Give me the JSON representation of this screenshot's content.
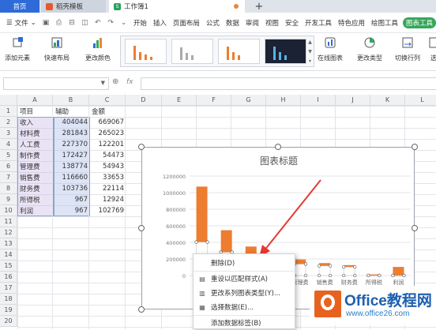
{
  "tabs": {
    "home": "首页",
    "doc": "稻壳模板",
    "workbook": "工作簿1",
    "new_tab": "+"
  },
  "menu": {
    "file": "文件",
    "items": [
      "开始",
      "插入",
      "页面布局",
      "公式",
      "数据",
      "审阅",
      "视图",
      "安全",
      "开发工具",
      "特色应用",
      "绘图工具"
    ],
    "chart_tools": "图表工具"
  },
  "ribbon": {
    "add_element": "添加元素",
    "quick_layout": "快速布局",
    "change_color": "更改颜色",
    "online_chart": "在线图表",
    "change_type": "更改类型",
    "switch_rowcol": "切换行列",
    "select_data": "选"
  },
  "formula": {
    "fx": "fx",
    "name_value": "",
    "formula_value": ""
  },
  "columns": [
    "A",
    "B",
    "C",
    "D",
    "E",
    "F",
    "G",
    "H",
    "I",
    "J",
    "K",
    "L"
  ],
  "rows": [
    "1",
    "2",
    "3",
    "4",
    "5",
    "6",
    "7",
    "8",
    "9",
    "10",
    "11",
    "12",
    "13",
    "14",
    "15",
    "16",
    "17",
    "18",
    "19",
    "20"
  ],
  "table": {
    "header": [
      "项目",
      "辅助",
      "金额"
    ],
    "data": [
      [
        "收入",
        "404044",
        "669067"
      ],
      [
        "材料费",
        "281843",
        "265023"
      ],
      [
        "人工费",
        "227370",
        "122201"
      ],
      [
        "制作费",
        "172427",
        "54473"
      ],
      [
        "管理费",
        "138774",
        "54943"
      ],
      [
        "销售费",
        "116660",
        "33653"
      ],
      [
        "财务费",
        "103736",
        "22114"
      ],
      [
        "所得税",
        "967",
        "12924"
      ],
      [
        "利润",
        "967",
        "102769"
      ]
    ]
  },
  "chart_data": {
    "type": "bar",
    "title": "图表标题",
    "categories": [
      "收入",
      "材料费",
      "人工费",
      "制作费",
      "管理费",
      "销售费",
      "财务费",
      "所得税",
      "利润"
    ],
    "series": [
      {
        "values": [
          404044,
          281843,
          227370,
          172427,
          138774,
          116660,
          103736,
          967,
          967
        ],
        "color": "#ffffff",
        "selected": true
      },
      {
        "values": [
          669067,
          265023,
          122201,
          54473,
          54943,
          33653,
          22114,
          12924,
          102769
        ],
        "color": "#ed7d31"
      }
    ],
    "stacked": true,
    "ylim": [
      0,
      1200000
    ],
    "yticks": [
      "0",
      "200000",
      "400000",
      "600000",
      "800000",
      "1000000",
      "1200000"
    ],
    "grid": true,
    "legend": "none"
  },
  "context_menu": {
    "delete": "删除(D)",
    "reset_style": "重设以匹配样式(A)",
    "change_series_type": "更改系列图表类型(Y)...",
    "select_data": "选择数据(E)...",
    "add_labels": "添加数据标签(B)"
  },
  "watermark": {
    "brand": "Office教程网",
    "url": "www.office26.com"
  },
  "colors": {
    "accent": "#2f6bd8",
    "bar": "#ed7d31",
    "green": "#36a65a"
  }
}
